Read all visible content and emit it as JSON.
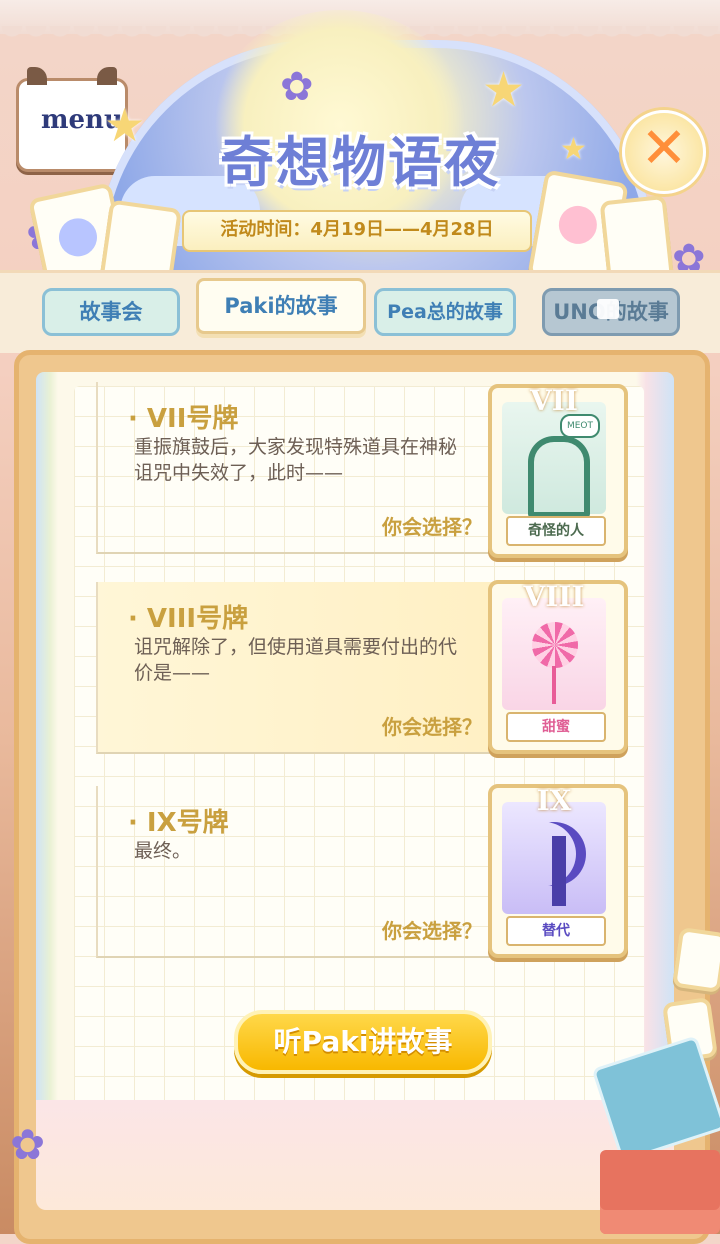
{
  "header": {
    "menu_label": "menu",
    "title": "奇想物语夜",
    "event_time": "活动时间：4月19日——4月28日",
    "close_symbol": "✕"
  },
  "tabs": [
    {
      "label": "故事会",
      "state": "normal"
    },
    {
      "label": "Paki的故事",
      "state": "active"
    },
    {
      "label": "Pea总的故事",
      "state": "normal"
    },
    {
      "label": "UNO的故事",
      "state": "locked"
    }
  ],
  "stories": [
    {
      "title": "· VII号牌",
      "text": "重振旗鼓后，大家发现特殊道具在神秘诅咒中失效了，此时——",
      "choose": "你会选择？",
      "card_numeral": "VII",
      "card_name": "奇怪的人",
      "card_speech": "MEOT",
      "card_color": "#3f8a6f",
      "highlight": false
    },
    {
      "title": "· VIII号牌",
      "text": "诅咒解除了，但使用道具需要付出的代价是——",
      "choose": "你会选择？",
      "card_numeral": "VIII",
      "card_name": "甜蜜",
      "card_color": "#f3a6c8",
      "highlight": true
    },
    {
      "title": "· IX号牌",
      "text": "最终。",
      "choose": "你会选择？",
      "card_numeral": "IX",
      "card_name": "替代",
      "card_color": "#8f7be0",
      "highlight": false
    }
  ],
  "cta": {
    "label": "听Paki讲故事"
  },
  "icons": [
    "moon",
    "star-icon",
    "lavender-flower-icon",
    "close-icon",
    "lock-icon",
    "tarot-card-icon",
    "book-icon"
  ],
  "colors": {
    "accent": "#c9a03f",
    "tab_blue": "#3f7fb5",
    "cta": "#f8b800",
    "close": "#ff8f3a"
  }
}
